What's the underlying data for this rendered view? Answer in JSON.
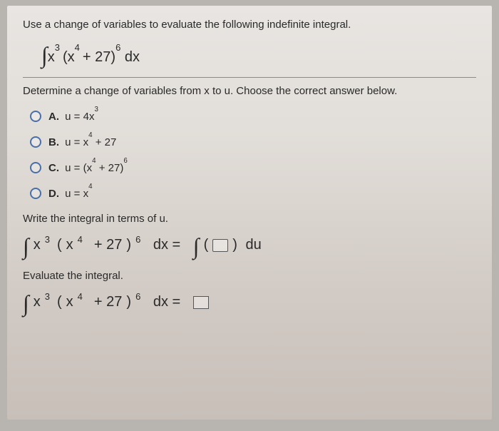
{
  "prompt": "Use a change of variables to evaluate the following indefinite integral.",
  "integral": {
    "int_symbol": "∫",
    "expr_base": "x",
    "expr_exp1": "3",
    "paren_inner_a": "x",
    "paren_exp_a": "4",
    "paren_plus_const": "+ 27",
    "outer_exp": "6",
    "dx": "dx"
  },
  "subprompt": "Determine a change of variables from x to u. Choose the correct answer below.",
  "options": {
    "A": {
      "letter": "A.",
      "lead": "u = 4x",
      "sup": "3"
    },
    "B": {
      "letter": "B.",
      "lead": "u = x",
      "sup": "4",
      "tail": " + 27"
    },
    "C": {
      "letter": "C.",
      "lead": "u = ",
      "paren_base": "x",
      "paren_sup": "4",
      "paren_tail": " + 27",
      "outer_sup": "6"
    },
    "D": {
      "letter": "D.",
      "lead": "u = x",
      "sup": "4"
    }
  },
  "section2": "Write the integral in terms of u.",
  "eq2": {
    "equals": "dx =",
    "du": "du"
  },
  "section3": "Evaluate the integral.",
  "eq3": {
    "equals": "dx ="
  }
}
